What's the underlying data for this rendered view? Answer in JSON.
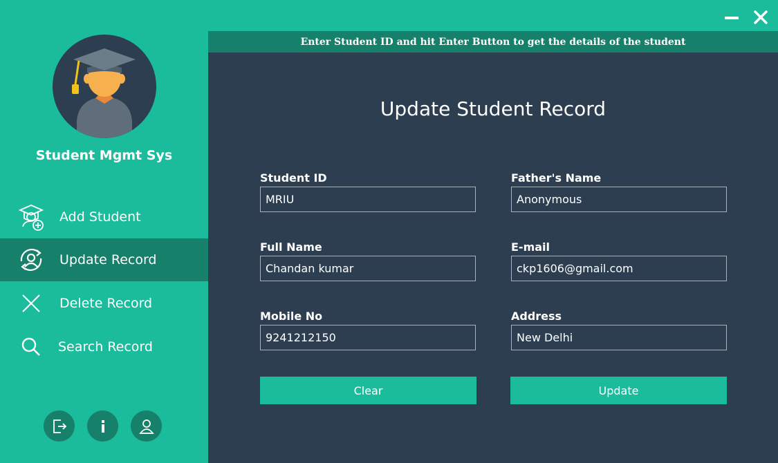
{
  "window": {
    "minimize_icon": "minimize-icon",
    "close_icon": "close-icon"
  },
  "sidebar": {
    "brand": "Student Mgmt Sys",
    "items": [
      {
        "label": "Add Student",
        "icon": "student-add-icon",
        "active": false
      },
      {
        "label": "Update Record",
        "icon": "user-refresh-icon",
        "active": true
      },
      {
        "label": "Delete Record",
        "icon": "close-x-icon",
        "active": false
      },
      {
        "label": "Search Record",
        "icon": "search-icon",
        "active": false
      }
    ],
    "bottom_icons": [
      "logout-icon",
      "info-icon",
      "user-icon"
    ]
  },
  "main": {
    "banner": "Enter Student ID and hit Enter Button to get the details of the student",
    "heading": "Update Student Record",
    "fields": {
      "student_id": {
        "label": "Student ID",
        "value": "MRIU"
      },
      "father_name": {
        "label": "Father's Name",
        "value": "Anonymous"
      },
      "full_name": {
        "label": "Full Name",
        "value": "Chandan kumar"
      },
      "email": {
        "label": "E-mail",
        "value": "ckp1606@gmail.com"
      },
      "mobile": {
        "label": "Mobile No",
        "value": "9241212150"
      },
      "address": {
        "label": "Address",
        "value": "New Delhi"
      }
    },
    "buttons": {
      "clear": "Clear",
      "update": "Update"
    }
  },
  "colors": {
    "accent": "#1abc9c",
    "accent_dark": "#16806a",
    "panel": "#2c3e50",
    "text": "#ffffff"
  }
}
